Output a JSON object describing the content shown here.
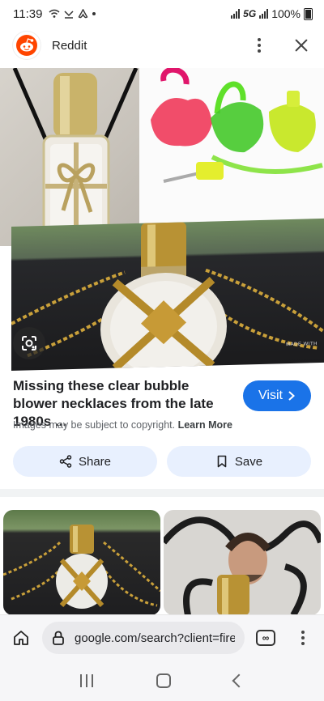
{
  "status": {
    "time": "11:39",
    "network": "5G",
    "battery": "100%"
  },
  "header": {
    "site_name": "Reddit",
    "logo_icon": "reddit-snoo-icon"
  },
  "result": {
    "title": "Missing these clear bubble blower necklaces from the late 1980s ...",
    "visit_label": "Visit",
    "copyright_note": "Images may be subject to copyright.",
    "learn_more": "Learn More",
    "watermark": "MADE WITH"
  },
  "actions": {
    "share_label": "Share",
    "save_label": "Save"
  },
  "browser": {
    "url": "google.com/search?client=firefox"
  },
  "colors": {
    "accent": "#1a73e8",
    "pill_bg": "#e8f0fe",
    "reddit_orange": "#ff4500"
  }
}
